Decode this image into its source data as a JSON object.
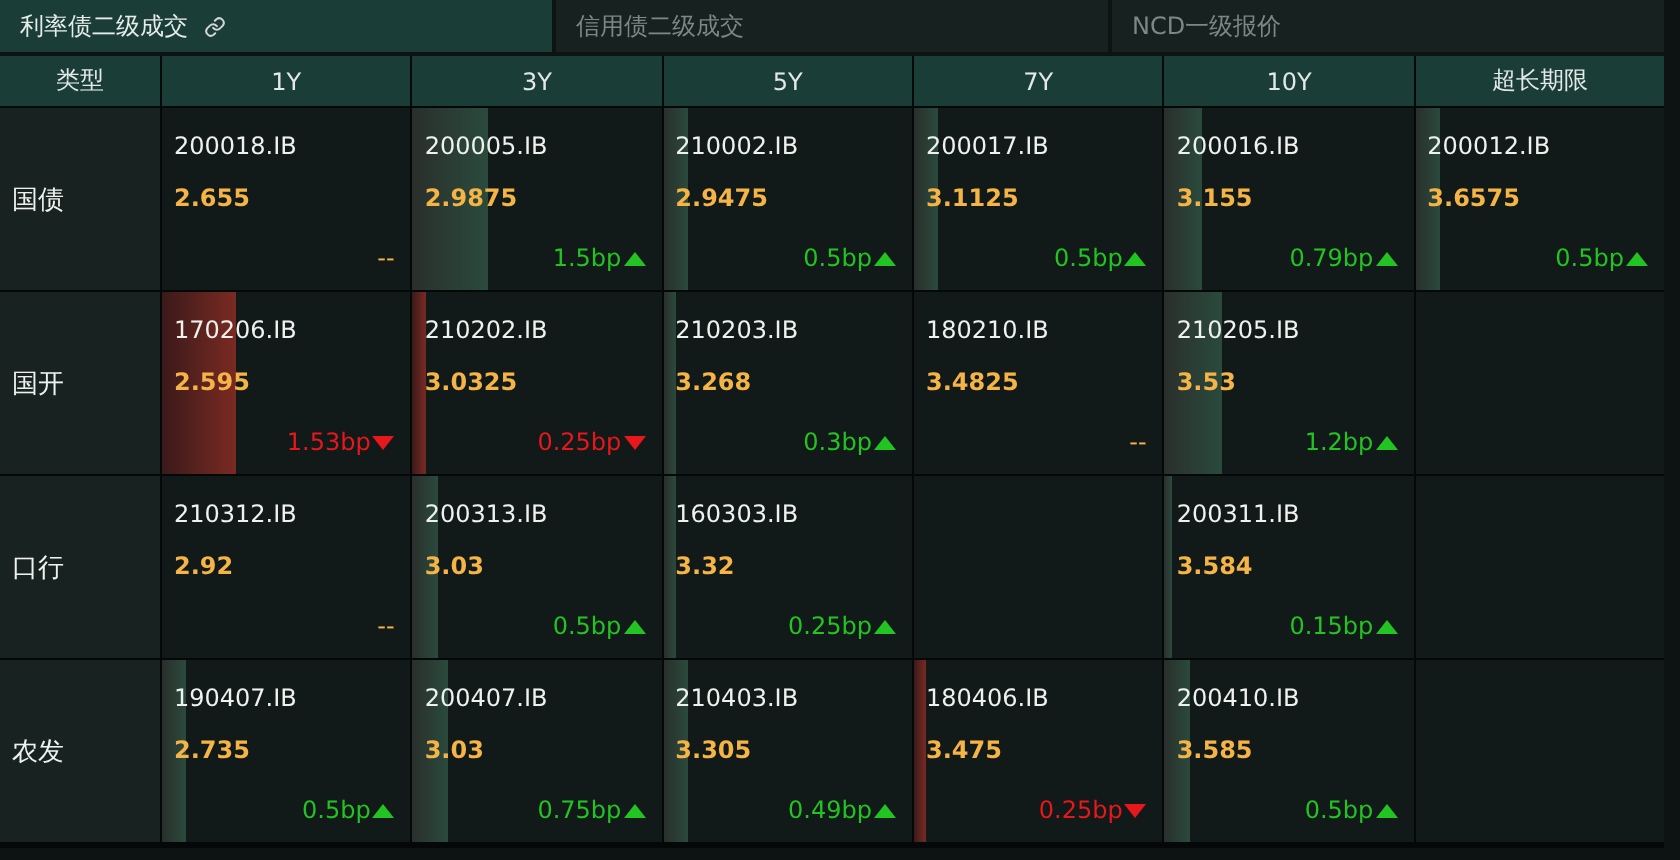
{
  "tabs": [
    {
      "label": "利率债二级成交",
      "selected": true,
      "link_icon": true
    },
    {
      "label": "信用债二级成交",
      "selected": false,
      "link_icon": false
    },
    {
      "label": "NCD一级报价",
      "selected": false,
      "link_icon": false
    }
  ],
  "table": {
    "columns": [
      "类型",
      "1Y",
      "3Y",
      "5Y",
      "7Y",
      "10Y",
      "超长期限"
    ],
    "rows": [
      {
        "cells": [
          {
            "kind": "type",
            "text": "国债"
          },
          {
            "kind": "flat",
            "code": "200018.IB",
            "yield": "2.655",
            "change": "--"
          },
          {
            "kind": "up",
            "code": "200005.IB",
            "yield": "2.9875",
            "change": "1.5bp",
            "level": 0.3
          },
          {
            "kind": "up",
            "code": "210002.IB",
            "yield": "2.9475",
            "change": "0.5bp",
            "level": 0.1
          },
          {
            "kind": "up",
            "code": "200017.IB",
            "yield": "3.1125",
            "change": "0.5bp",
            "level": 0.1
          },
          {
            "kind": "up",
            "code": "200016.IB",
            "yield": "3.155",
            "change": "0.79bp",
            "level": 0.15
          },
          {
            "kind": "up",
            "code": "200012.IB",
            "yield": "3.6575",
            "change": "0.5bp",
            "level": 0.1
          }
        ]
      },
      {
        "cells": [
          {
            "kind": "type",
            "text": "国开"
          },
          {
            "kind": "down",
            "code": "170206.IB",
            "yield": "2.595",
            "change": "1.53bp",
            "level": 0.3
          },
          {
            "kind": "down",
            "code": "210202.IB",
            "yield": "3.0325",
            "change": "0.25bp",
            "level": 0.05
          },
          {
            "kind": "up",
            "code": "210203.IB",
            "yield": "3.268",
            "change": "0.3bp",
            "level": 0.05
          },
          {
            "kind": "flat",
            "code": "180210.IB",
            "yield": "3.4825",
            "change": "--"
          },
          {
            "kind": "up",
            "code": "210205.IB",
            "yield": "3.53",
            "change": "1.2bp",
            "level": 0.23
          },
          ""
        ]
      },
      {
        "cells": [
          {
            "kind": "type",
            "text": "口行"
          },
          {
            "kind": "flat",
            "code": "210312.IB",
            "yield": "2.92",
            "change": "--"
          },
          {
            "kind": "up",
            "code": "200313.IB",
            "yield": "3.03",
            "change": "0.5bp",
            "level": 0.1
          },
          {
            "kind": "up",
            "code": "160303.IB",
            "yield": "3.32",
            "change": "0.25bp",
            "level": 0.05
          },
          "",
          {
            "kind": "up",
            "code": "200311.IB",
            "yield": "3.584",
            "change": "0.15bp",
            "level": 0.03
          },
          ""
        ]
      },
      {
        "cells": [
          {
            "kind": "type",
            "text": "农发"
          },
          {
            "kind": "up",
            "code": "190407.IB",
            "yield": "2.735",
            "change": "0.5bp",
            "level": 0.1
          },
          {
            "kind": "up",
            "code": "200407.IB",
            "yield": "3.03",
            "change": "0.75bp",
            "level": 0.14
          },
          {
            "kind": "up",
            "code": "210403.IB",
            "yield": "3.305",
            "change": "0.49bp",
            "level": 0.1
          },
          {
            "kind": "down",
            "code": "180406.IB",
            "yield": "3.475",
            "change": "0.25bp",
            "level": 0.05
          },
          {
            "kind": "up",
            "code": "200410.IB",
            "yield": "3.585",
            "change": "0.5bp",
            "level": 0.1
          },
          ""
        ]
      }
    ]
  }
}
